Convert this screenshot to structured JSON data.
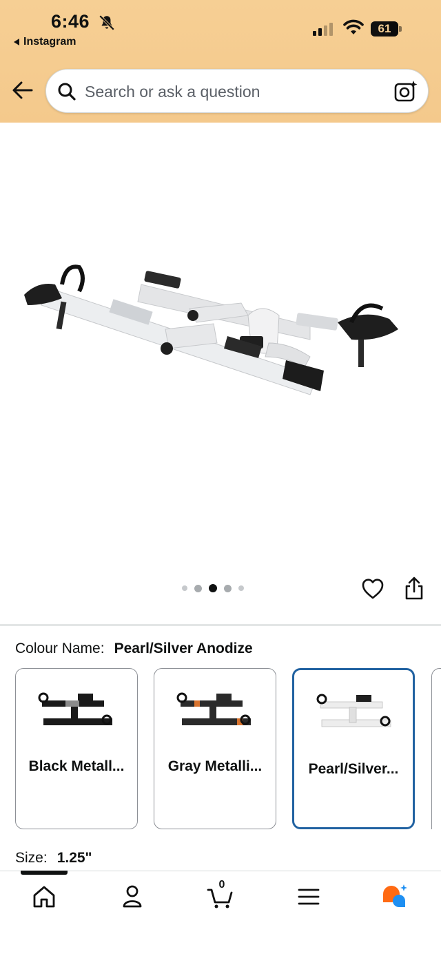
{
  "status_bar": {
    "time": "6:46",
    "back_app": "Instagram",
    "battery": "61"
  },
  "search": {
    "placeholder": "Search or ask a question"
  },
  "gallery": {
    "image_count": 5,
    "active_index": 2
  },
  "colour": {
    "label": "Colour Name:",
    "selected": "Pearl/Silver Anodize",
    "options": [
      {
        "name": "Black Metall...",
        "bar_color": "#1a1a1a"
      },
      {
        "name": "Gray Metalli...",
        "bar_color": "#2a2a2a"
      },
      {
        "name": "Pearl/Silver...",
        "bar_color": "#e6e6e6"
      }
    ]
  },
  "size": {
    "label": "Size:",
    "value": "1.25\""
  },
  "bottom_nav": {
    "cart_count": "0",
    "items": [
      "home-icon",
      "account-icon",
      "cart-icon",
      "menu-icon",
      "rufus-icon"
    ]
  },
  "colors": {
    "header_bg": "#f6cf94",
    "selected_border": "#2162a1",
    "rufus_orange": "#ff6a13",
    "rufus_blue": "#1e8ff2"
  }
}
